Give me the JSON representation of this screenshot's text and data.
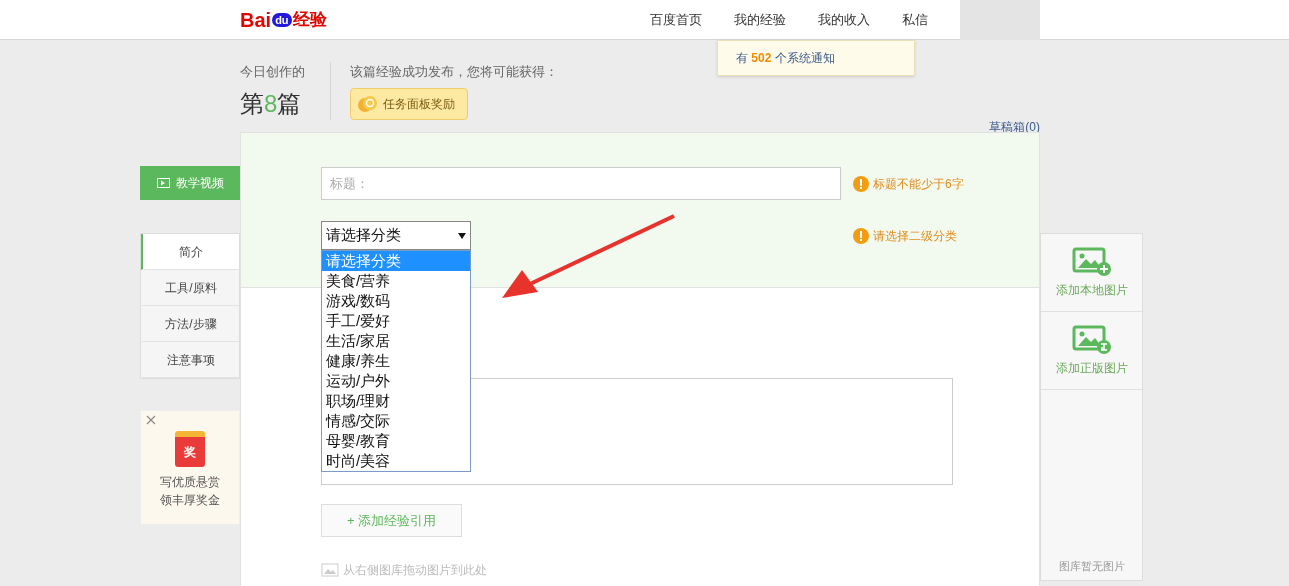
{
  "header": {
    "logo": {
      "left": "Bai",
      "paw": "du",
      "right": "经验"
    },
    "nav": [
      {
        "label": "百度首页"
      },
      {
        "label": "我的经验"
      },
      {
        "label": "我的收入"
      },
      {
        "label": "私信"
      }
    ],
    "notification": {
      "prefix": "有",
      "count": "502",
      "suffix": "个系统通知"
    }
  },
  "stats": {
    "label": "今日创作的",
    "count_prefix": "第",
    "count": "8",
    "count_suffix": "篇",
    "reward_note": "该篇经验成功发布，您将可能获得：",
    "reward_button": "任务面板奖励",
    "drafts": "草稿箱(0)"
  },
  "left_sidebar": {
    "video_button": "教学视频",
    "sections": [
      {
        "label": "简介",
        "selected": true
      },
      {
        "label": "工具/原料",
        "selected": false
      },
      {
        "label": "方法/步骤",
        "selected": false
      },
      {
        "label": "注意事项",
        "selected": false
      }
    ],
    "promo": {
      "badge": "奖",
      "line_1": "写优质悬赏",
      "line_2": "领丰厚奖金"
    }
  },
  "form": {
    "title_field": {
      "placeholder": "标题："
    },
    "title_warning": "标题不能少于6字",
    "category_select": {
      "value": "请选择分类",
      "expanded": true,
      "options": [
        {
          "label": "请选择分类",
          "selected": true
        },
        {
          "label": "美食/营养",
          "selected": false
        },
        {
          "label": "游戏/数码",
          "selected": false
        },
        {
          "label": "手工/爱好",
          "selected": false
        },
        {
          "label": "生活/家居",
          "selected": false
        },
        {
          "label": "健康/养生",
          "selected": false
        },
        {
          "label": "运动/户外",
          "selected": false
        },
        {
          "label": "职场/理财",
          "selected": false
        },
        {
          "label": "情感/交际",
          "selected": false
        },
        {
          "label": "母婴/教育",
          "selected": false
        },
        {
          "label": "时尚/美容",
          "selected": false
        }
      ]
    },
    "category_warning": "请选择二级分类",
    "add_reference_button": "+ 添加经验引用",
    "drag_hint": "从右侧图库拖动图片到此处"
  },
  "right_panel": {
    "buttons": [
      {
        "label": "添加本地图片",
        "kind": "plus"
      },
      {
        "label": "添加正版图片",
        "kind": "licensed"
      }
    ],
    "empty_text": "图库暂无图片"
  }
}
